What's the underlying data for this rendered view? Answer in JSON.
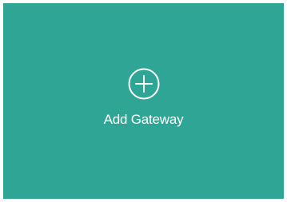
{
  "card": {
    "icon": "plus-circle-icon",
    "label": "Add Gateway",
    "background_color": "#2fa595",
    "text_color": "#ffffff"
  }
}
